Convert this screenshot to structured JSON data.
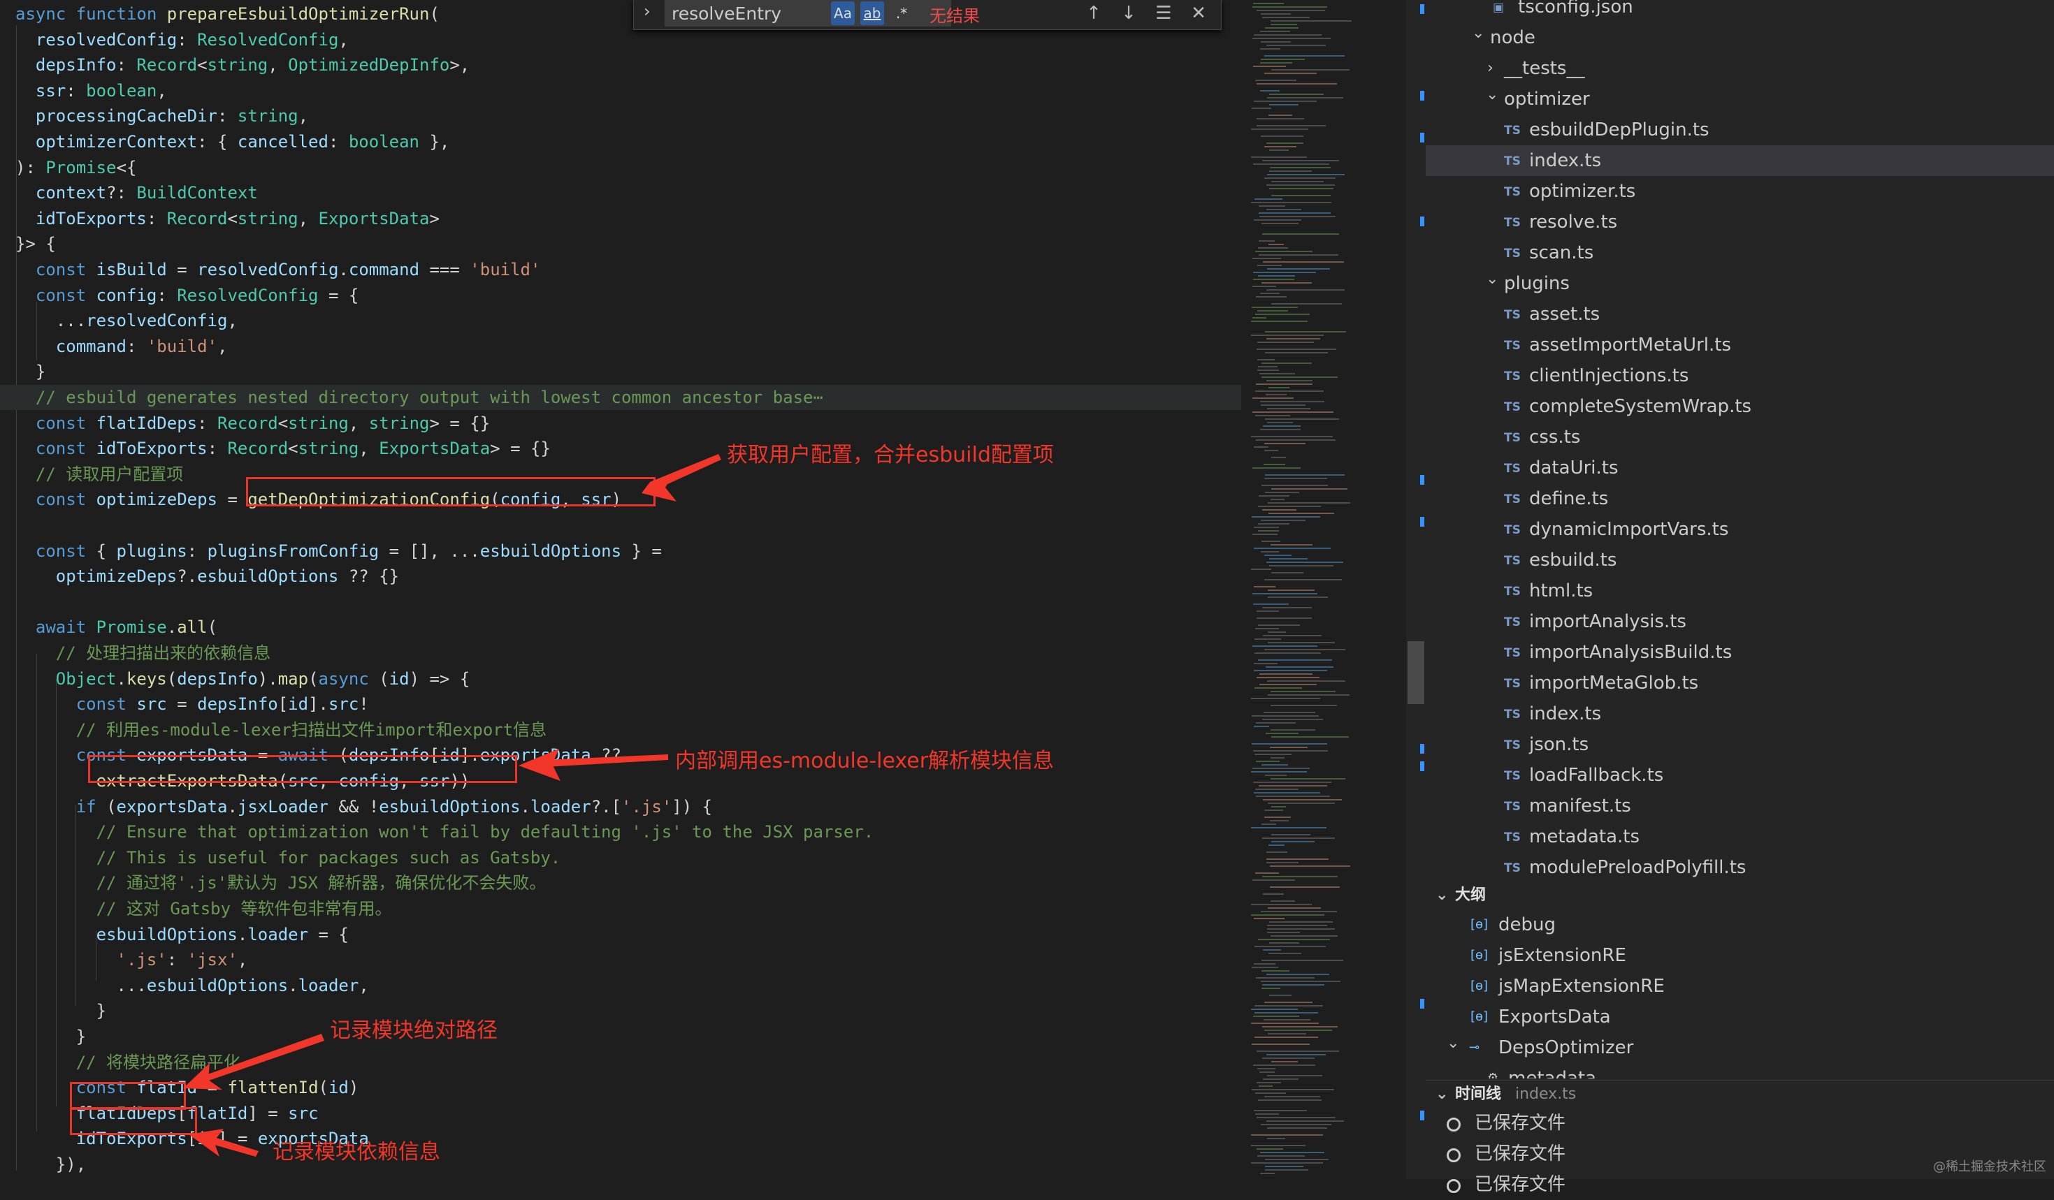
{
  "find": {
    "query": "resolveEntry",
    "match_case_label": "Aa",
    "whole_word_label": "ab",
    "regex_label": ".*",
    "result_text": "无结果",
    "prev_icon": "arrow-up-icon",
    "next_icon": "arrow-down-icon",
    "selection_icon": "find-in-selection-icon",
    "close_icon": "close-icon"
  },
  "code_lines": [
    "async function prepareEsbuildOptimizerRun(",
    "  resolvedConfig: ResolvedConfig,",
    "  depsInfo: Record<string, OptimizedDepInfo>,",
    "  ssr: boolean,",
    "  processingCacheDir: string,",
    "  optimizerContext: { cancelled: boolean },",
    "): Promise<{",
    "  context?: BuildContext",
    "  idToExports: Record<string, ExportsData>",
    "}> {",
    "  const isBuild = resolvedConfig.command === 'build'",
    "  const config: ResolvedConfig = {",
    "    ...resolvedConfig,",
    "    command: 'build',",
    "  }",
    "  // esbuild generates nested directory output with lowest common ancestor base⋯",
    "  const flatIdDeps: Record<string, string> = {}",
    "  const idToExports: Record<string, ExportsData> = {}",
    "  // 读取用户配置项",
    "  const optimizeDeps = getDepOptimizationConfig(config, ssr)",
    "",
    "  const { plugins: pluginsFromConfig = [], ...esbuildOptions } =",
    "    optimizeDeps?.esbuildOptions ?? {}",
    "",
    "  await Promise.all(",
    "    // 处理扫描出来的依赖信息",
    "    Object.keys(depsInfo).map(async (id) => {",
    "      const src = depsInfo[id].src!",
    "      // 利用es-module-lexer扫描出文件import和export信息",
    "      const exportsData = await (depsInfo[id].exportsData ??",
    "        extractExportsData(src, config, ssr))",
    "      if (exportsData.jsxLoader && !esbuildOptions.loader?.['.js']) {",
    "        // Ensure that optimization won't fail by defaulting '.js' to the JSX parser.",
    "        // This is useful for packages such as Gatsby.",
    "        // 通过将'.js'默认为 JSX 解析器，确保优化不会失败。",
    "        // 这对 Gatsby 等软件包非常有用。",
    "        esbuildOptions.loader = {",
    "          '.js': 'jsx',",
    "          ...esbuildOptions.loader,",
    "        }",
    "      }",
    "      // 将模块路径扁平化",
    "      const flatId = flattenId(id)",
    "      flatIdDeps[flatId] = src",
    "      idToExports[id] = exportsData",
    "    }),",
    "  )"
  ],
  "annotations": {
    "a1": "获取用户配置，合并esbuild配置项",
    "a2": "内部调用es-module-lexer解析模块信息",
    "a3": "记录模块绝对路径",
    "a4": "记录模块依赖信息"
  },
  "explorer": {
    "items": [
      {
        "label": "tsconfig.json",
        "icon": "json-file-icon"
      },
      {
        "label": "node",
        "icon": "chevron-down-icon"
      },
      {
        "label": "__tests__",
        "icon": "chevron-right-icon"
      },
      {
        "label": "optimizer",
        "icon": "chevron-down-icon"
      },
      {
        "label": "esbuildDepPlugin.ts",
        "icon": "ts-file-icon"
      },
      {
        "label": "index.ts",
        "icon": "ts-file-icon"
      },
      {
        "label": "optimizer.ts",
        "icon": "ts-file-icon"
      },
      {
        "label": "resolve.ts",
        "icon": "ts-file-icon"
      },
      {
        "label": "scan.ts",
        "icon": "ts-file-icon"
      },
      {
        "label": "plugins",
        "icon": "chevron-down-icon"
      },
      {
        "label": "asset.ts",
        "icon": "ts-file-icon"
      },
      {
        "label": "assetImportMetaUrl.ts",
        "icon": "ts-file-icon"
      },
      {
        "label": "clientInjections.ts",
        "icon": "ts-file-icon"
      },
      {
        "label": "completeSystemWrap.ts",
        "icon": "ts-file-icon"
      },
      {
        "label": "css.ts",
        "icon": "ts-file-icon"
      },
      {
        "label": "dataUri.ts",
        "icon": "ts-file-icon"
      },
      {
        "label": "define.ts",
        "icon": "ts-file-icon"
      },
      {
        "label": "dynamicImportVars.ts",
        "icon": "ts-file-icon"
      },
      {
        "label": "esbuild.ts",
        "icon": "ts-file-icon"
      },
      {
        "label": "html.ts",
        "icon": "ts-file-icon"
      },
      {
        "label": "importAnalysis.ts",
        "icon": "ts-file-icon"
      },
      {
        "label": "importAnalysisBuild.ts",
        "icon": "ts-file-icon"
      },
      {
        "label": "importMetaGlob.ts",
        "icon": "ts-file-icon"
      },
      {
        "label": "index.ts",
        "icon": "ts-file-icon"
      },
      {
        "label": "json.ts",
        "icon": "ts-file-icon"
      },
      {
        "label": "loadFallback.ts",
        "icon": "ts-file-icon"
      },
      {
        "label": "manifest.ts",
        "icon": "ts-file-icon"
      },
      {
        "label": "metadata.ts",
        "icon": "ts-file-icon"
      },
      {
        "label": "modulePreloadPolyfill.ts",
        "icon": "ts-file-icon"
      }
    ],
    "ts_badge": "TS"
  },
  "outline": {
    "title": "大纲",
    "items": [
      {
        "label": "debug",
        "icon": "variable-icon"
      },
      {
        "label": "jsExtensionRE",
        "icon": "variable-icon"
      },
      {
        "label": "jsMapExtensionRE",
        "icon": "variable-icon"
      },
      {
        "label": "ExportsData",
        "icon": "variable-icon"
      },
      {
        "label": "DepsOptimizer",
        "icon": "interface-icon"
      },
      {
        "label": "metadata",
        "icon": "property-icon"
      }
    ]
  },
  "timeline": {
    "title": "时间线",
    "file": "index.ts",
    "items": [
      {
        "label": "已保存文件"
      },
      {
        "label": "已保存文件"
      },
      {
        "label": "已保存文件"
      }
    ]
  },
  "watermark": "@稀土掘金技术社区",
  "colors": {
    "annotation": "#f2372a",
    "keyword": "#569cd6",
    "type": "#4ec9b0",
    "string": "#ce9178",
    "comment": "#6a9955",
    "function": "#dcdcaa",
    "variable": "#9cdcfe"
  }
}
